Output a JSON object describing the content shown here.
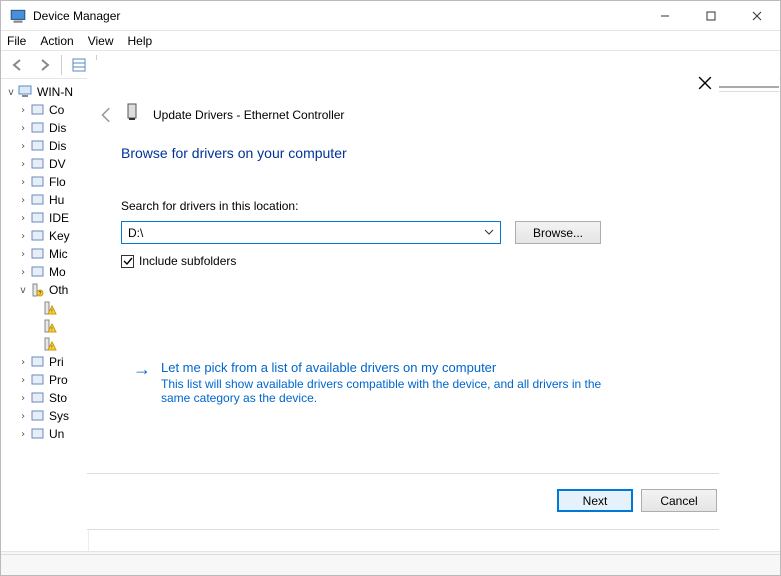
{
  "window_title": "Device Manager",
  "menubar": {
    "file": "File",
    "action": "Action",
    "view": "View",
    "help": "Help"
  },
  "tree": {
    "root": "WIN-N",
    "items": [
      {
        "label": "Co",
        "icon": "monitor"
      },
      {
        "label": "Dis",
        "icon": "disk"
      },
      {
        "label": "Dis",
        "icon": "display"
      },
      {
        "label": "DV",
        "icon": "dvd"
      },
      {
        "label": "Flo",
        "icon": "floppy"
      },
      {
        "label": "Hu",
        "icon": "hid"
      },
      {
        "label": "IDE",
        "icon": "ide"
      },
      {
        "label": "Key",
        "icon": "keyboard"
      },
      {
        "label": "Mic",
        "icon": "mouse"
      },
      {
        "label": "Mo",
        "icon": "monitor2"
      }
    ],
    "other_node": "Oth",
    "warn_items": [
      "",
      "",
      ""
    ],
    "items2": [
      {
        "label": "Pri",
        "icon": "printer"
      },
      {
        "label": "Pro",
        "icon": "cpu"
      },
      {
        "label": "Sto",
        "icon": "storage"
      },
      {
        "label": "Sys",
        "icon": "system"
      },
      {
        "label": "Un",
        "icon": "usb"
      }
    ]
  },
  "wizard": {
    "title": "Update Drivers - Ethernet Controller",
    "heading": "Browse for drivers on your computer",
    "search_label": "Search for drivers in this location:",
    "path_value": "D:\\",
    "browse_label": "Browse...",
    "include_subfolders_label": "Include subfolders",
    "include_subfolders_checked": true,
    "link_title": "Let me pick from a list of available drivers on my computer",
    "link_desc": "This list will show available drivers compatible with the device, and all drivers in the same category as the device.",
    "next_label": "Next",
    "cancel_label": "Cancel"
  }
}
